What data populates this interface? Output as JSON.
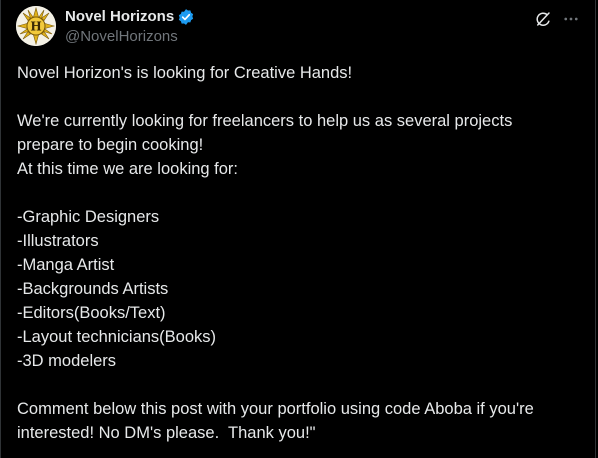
{
  "author": {
    "display_name": "Novel Horizons",
    "handle": "@NovelHorizons",
    "verified": true,
    "avatar_icon": "sun-logo-icon",
    "avatar_letter": "H"
  },
  "actions": {
    "grok_icon": "grok-icon",
    "more_icon": "more-icon"
  },
  "post": {
    "paragraph_1": [
      "Novel Horizon's is looking for Creative Hands!"
    ],
    "paragraph_2": [
      "We're currently looking for freelancers to help us as several projects",
      "prepare to begin cooking!",
      "At this time we are looking for:"
    ],
    "roles": [
      "-Graphic Designers",
      "-Illustrators",
      "-Manga Artist",
      "-Backgrounds Artists",
      "-Editors(Books/Text)",
      "-Layout technicians(Books)",
      "-3D modelers"
    ],
    "closing": [
      "Comment below this post with your portfolio using code Aboba if you're",
      "interested! No DM's please.  Thank you!\""
    ]
  },
  "colors": {
    "background": "#000000",
    "text": "#e7e9ea",
    "secondary_text": "#71767b",
    "verified_blue": "#1d9bf0"
  }
}
